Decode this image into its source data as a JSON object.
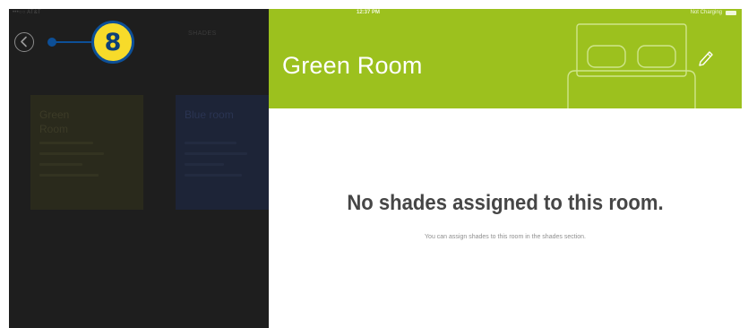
{
  "left_pane": {
    "status_text": "•••○○ AT&T",
    "title": "SHADES",
    "tiles": [
      {
        "label_line1": "Green",
        "label_line2": "Room"
      },
      {
        "label_line1": "Blue room",
        "label_line2": ""
      }
    ]
  },
  "callout": {
    "number": "8"
  },
  "detail": {
    "status_time": "12:37 PM",
    "status_battery": "Not Charging",
    "room_title": "Green Room",
    "empty_title": "No shades assigned to this room.",
    "empty_subtitle": "You can assign shades to this room in the shades section."
  },
  "colors": {
    "header_green": "#9cc11e",
    "callout_yellow": "#f7db2a",
    "callout_blue": "#0d4f97",
    "dim_background": "#1e1e1e"
  },
  "icons": {
    "back": "chevron-left-icon",
    "edit": "pencil-icon",
    "room": "bed-icon"
  }
}
